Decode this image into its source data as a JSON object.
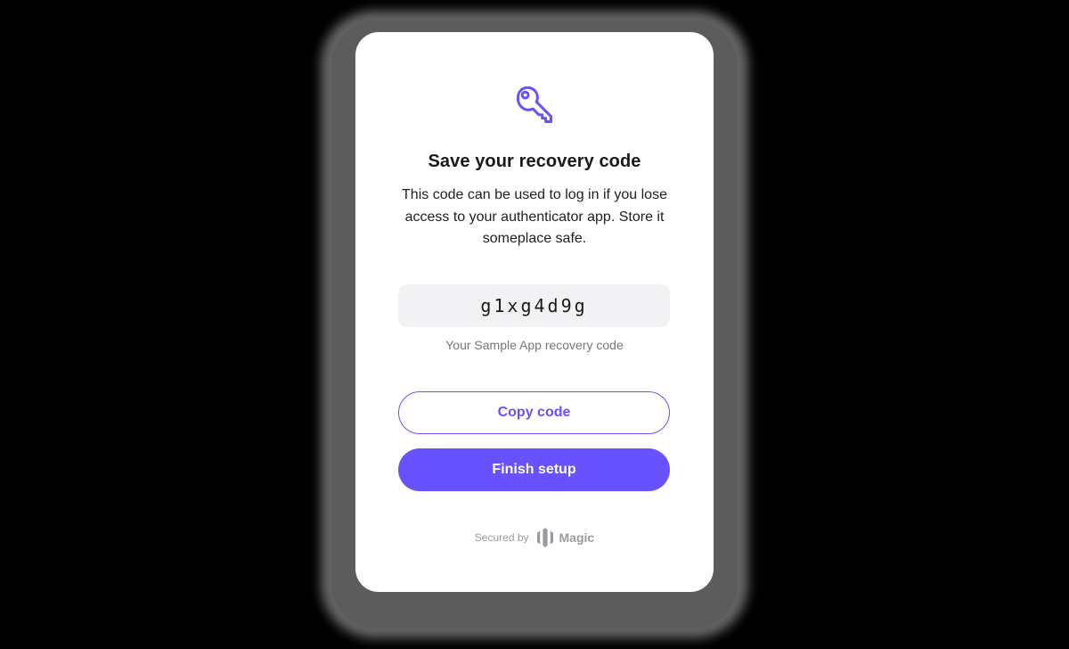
{
  "colors": {
    "accent": "#6851ff",
    "card_bg": "#ffffff",
    "code_bg": "#f2f2f4",
    "muted_text": "#77777c"
  },
  "dialog": {
    "icon": "key-icon",
    "title": "Save your recovery code",
    "description": "This code can be used to log in if you lose access to your authenticator app. Store it someplace safe.",
    "recovery_code": "g1xg4d9g",
    "code_caption": "Your Sample App recovery code",
    "copy_button_label": "Copy code",
    "finish_button_label": "Finish setup"
  },
  "footer": {
    "secured_by": "Secured by",
    "brand_name": "Magic",
    "brand_icon": "magic-logo-icon"
  }
}
